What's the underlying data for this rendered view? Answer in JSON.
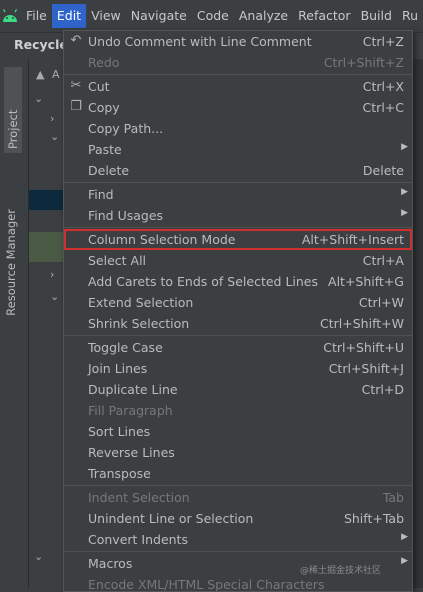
{
  "menubar": {
    "items": [
      "File",
      "Edit",
      "View",
      "Navigate",
      "Code",
      "Analyze",
      "Refactor",
      "Build",
      "Ru"
    ],
    "active_index": 1
  },
  "toolbar": {
    "title": "Recycler"
  },
  "toolstrip": {
    "project_label": "Project",
    "resource_label": "Resource Manager"
  },
  "panel": {
    "row_text": "A"
  },
  "edit_menu": {
    "items": [
      {
        "label": "Undo Comment with Line Comment",
        "shortcut": "Ctrl+Z",
        "icon": "undo-icon",
        "disabled": false
      },
      {
        "label": "Redo",
        "shortcut": "Ctrl+Shift+Z",
        "icon": "",
        "disabled": true
      },
      {
        "sep": true
      },
      {
        "label": "Cut",
        "shortcut": "Ctrl+X",
        "icon": "scissors-icon",
        "disabled": false
      },
      {
        "label": "Copy",
        "shortcut": "Ctrl+C",
        "icon": "copy-icon",
        "disabled": false
      },
      {
        "label": "Copy Path...",
        "shortcut": "",
        "icon": "",
        "disabled": false
      },
      {
        "label": "Paste",
        "shortcut": "",
        "icon": "",
        "submenu": true,
        "disabled": false
      },
      {
        "label": "Delete",
        "shortcut": "Delete",
        "icon": "",
        "disabled": false
      },
      {
        "sep": true
      },
      {
        "label": "Find",
        "shortcut": "",
        "icon": "",
        "submenu": true,
        "disabled": false
      },
      {
        "label": "Find Usages",
        "shortcut": "",
        "icon": "",
        "submenu": true,
        "disabled": false
      },
      {
        "sep": true
      },
      {
        "label": "Column Selection Mode",
        "shortcut": "Alt+Shift+Insert",
        "icon": "",
        "disabled": false,
        "highlight": true
      },
      {
        "label": "Select All",
        "shortcut": "Ctrl+A",
        "icon": "",
        "disabled": false
      },
      {
        "label": "Add Carets to Ends of Selected Lines",
        "shortcut": "Alt+Shift+G",
        "icon": "",
        "disabled": false
      },
      {
        "label": "Extend Selection",
        "shortcut": "Ctrl+W",
        "icon": "",
        "disabled": false
      },
      {
        "label": "Shrink Selection",
        "shortcut": "Ctrl+Shift+W",
        "icon": "",
        "disabled": false
      },
      {
        "sep": true
      },
      {
        "label": "Toggle Case",
        "shortcut": "Ctrl+Shift+U",
        "icon": "",
        "disabled": false
      },
      {
        "label": "Join Lines",
        "shortcut": "Ctrl+Shift+J",
        "icon": "",
        "disabled": false
      },
      {
        "label": "Duplicate Line",
        "shortcut": "Ctrl+D",
        "icon": "",
        "disabled": false
      },
      {
        "label": "Fill Paragraph",
        "shortcut": "",
        "icon": "",
        "disabled": true
      },
      {
        "label": "Sort Lines",
        "shortcut": "",
        "icon": "",
        "disabled": false
      },
      {
        "label": "Reverse Lines",
        "shortcut": "",
        "icon": "",
        "disabled": false
      },
      {
        "label": "Transpose",
        "shortcut": "",
        "icon": "",
        "disabled": false
      },
      {
        "sep": true
      },
      {
        "label": "Indent Selection",
        "shortcut": "Tab",
        "icon": "",
        "disabled": true
      },
      {
        "label": "Unindent Line or Selection",
        "shortcut": "Shift+Tab",
        "icon": "",
        "disabled": false
      },
      {
        "label": "Convert Indents",
        "shortcut": "",
        "icon": "",
        "submenu": true,
        "disabled": false
      },
      {
        "sep": true
      },
      {
        "label": "Macros",
        "shortcut": "",
        "icon": "",
        "submenu": true,
        "disabled": false
      },
      {
        "label": "Encode XML/HTML Special Characters",
        "shortcut": "",
        "icon": "",
        "disabled": true
      }
    ]
  },
  "watermark": "@稀土掘金技术社区",
  "colors": {
    "background": "#3c3f41",
    "active_menu": "#2f65ca",
    "highlight_border": "#d12f2f",
    "android_green": "#3ddc84"
  }
}
